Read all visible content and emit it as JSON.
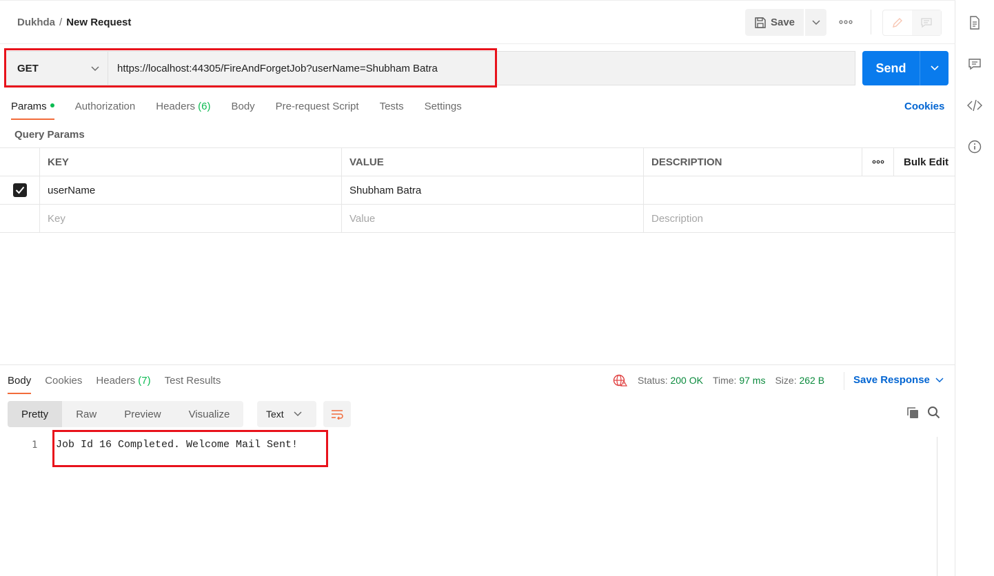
{
  "header": {
    "workspace": "Dukhda",
    "separator": "/",
    "request_name": "New Request",
    "save_label": "Save",
    "more_icon": "more-horizontal-icon"
  },
  "request": {
    "method": "GET",
    "url": "https://localhost:44305/FireAndForgetJob?userName=Shubham Batra",
    "send_label": "Send"
  },
  "request_tabs": [
    {
      "label": "Params",
      "count": ""
    },
    {
      "label": "Authorization",
      "count": ""
    },
    {
      "label": "Headers",
      "count": "(6)"
    },
    {
      "label": "Body",
      "count": ""
    },
    {
      "label": "Pre-request Script",
      "count": ""
    },
    {
      "label": "Tests",
      "count": ""
    },
    {
      "label": "Settings",
      "count": ""
    }
  ],
  "cookies_label": "Cookies",
  "query_params": {
    "title": "Query Params",
    "columns": [
      "KEY",
      "VALUE",
      "DESCRIPTION"
    ],
    "bulk_edit": "Bulk Edit",
    "rows": [
      {
        "checked": true,
        "key": "userName",
        "value": "Shubham Batra",
        "description": ""
      }
    ],
    "placeholders": {
      "key": "Key",
      "value": "Value",
      "description": "Description"
    }
  },
  "response": {
    "tabs": [
      {
        "label": "Body",
        "count": ""
      },
      {
        "label": "Cookies",
        "count": ""
      },
      {
        "label": "Headers",
        "count": "(7)"
      },
      {
        "label": "Test Results",
        "count": ""
      }
    ],
    "status_label": "Status:",
    "status_value": "200 OK",
    "time_label": "Time:",
    "time_value": "97 ms",
    "size_label": "Size:",
    "size_value": "262 B",
    "save_response": "Save Response",
    "views": [
      "Pretty",
      "Raw",
      "Preview",
      "Visualize"
    ],
    "format": "Text",
    "line_number": "1",
    "body_line": "Job Id 16 Completed. Welcome Mail Sent!"
  },
  "colors": {
    "accent_orange": "#f26b3a",
    "send_blue": "#097bed",
    "link_blue": "#0265d2",
    "success_green": "#0a8a3c",
    "highlight_red": "#e8121b"
  }
}
